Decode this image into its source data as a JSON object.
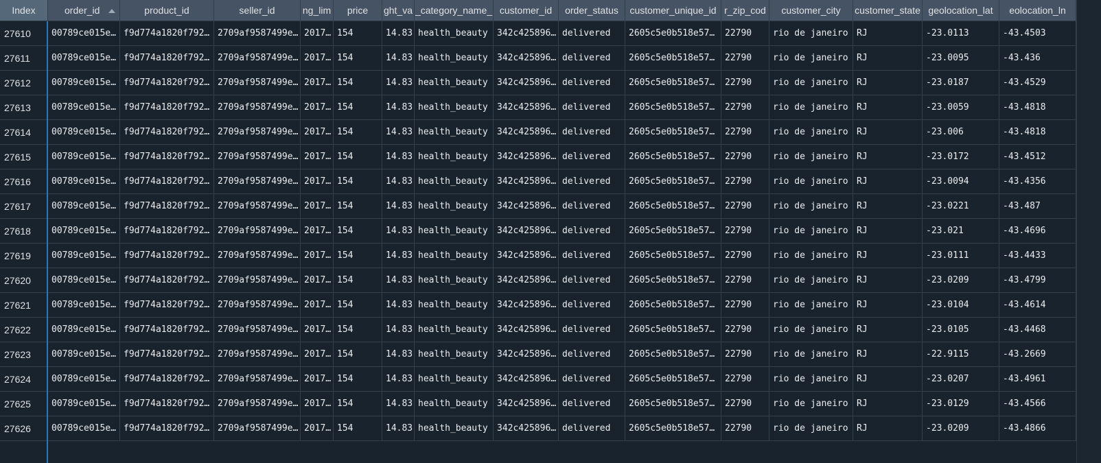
{
  "table": {
    "index_header": "Index",
    "columns": [
      "order_id",
      "product_id",
      "seller_id",
      "ng_lim",
      "price",
      "ght_va",
      "_category_name_",
      "customer_id",
      "order_status",
      "customer_unique_id",
      "r_zip_cod",
      "customer_city",
      "customer_state",
      "geolocation_lat",
      "eolocation_ln"
    ],
    "sorted_column": "order_id",
    "rows": [
      {
        "index": "27610",
        "cells": [
          "00789ce015e…",
          "f9d774a1820f792…",
          "2709af9587499e…",
          "2017…",
          "154",
          "14.83",
          "health_beauty",
          "342c425896…",
          "delivered",
          "2605c5e0b518e57…",
          "22790",
          "rio de janeiro",
          "RJ",
          "-23.0113",
          "-43.4503"
        ]
      },
      {
        "index": "27611",
        "cells": [
          "00789ce015e…",
          "f9d774a1820f792…",
          "2709af9587499e…",
          "2017…",
          "154",
          "14.83",
          "health_beauty",
          "342c425896…",
          "delivered",
          "2605c5e0b518e57…",
          "22790",
          "rio de janeiro",
          "RJ",
          "-23.0095",
          "-43.436"
        ]
      },
      {
        "index": "27612",
        "cells": [
          "00789ce015e…",
          "f9d774a1820f792…",
          "2709af9587499e…",
          "2017…",
          "154",
          "14.83",
          "health_beauty",
          "342c425896…",
          "delivered",
          "2605c5e0b518e57…",
          "22790",
          "rio de janeiro",
          "RJ",
          "-23.0187",
          "-43.4529"
        ]
      },
      {
        "index": "27613",
        "cells": [
          "00789ce015e…",
          "f9d774a1820f792…",
          "2709af9587499e…",
          "2017…",
          "154",
          "14.83",
          "health_beauty",
          "342c425896…",
          "delivered",
          "2605c5e0b518e57…",
          "22790",
          "rio de janeiro",
          "RJ",
          "-23.0059",
          "-43.4818"
        ]
      },
      {
        "index": "27614",
        "cells": [
          "00789ce015e…",
          "f9d774a1820f792…",
          "2709af9587499e…",
          "2017…",
          "154",
          "14.83",
          "health_beauty",
          "342c425896…",
          "delivered",
          "2605c5e0b518e57…",
          "22790",
          "rio de janeiro",
          "RJ",
          "-23.006",
          "-43.4818"
        ]
      },
      {
        "index": "27615",
        "cells": [
          "00789ce015e…",
          "f9d774a1820f792…",
          "2709af9587499e…",
          "2017…",
          "154",
          "14.83",
          "health_beauty",
          "342c425896…",
          "delivered",
          "2605c5e0b518e57…",
          "22790",
          "rio de janeiro",
          "RJ",
          "-23.0172",
          "-43.4512"
        ]
      },
      {
        "index": "27616",
        "cells": [
          "00789ce015e…",
          "f9d774a1820f792…",
          "2709af9587499e…",
          "2017…",
          "154",
          "14.83",
          "health_beauty",
          "342c425896…",
          "delivered",
          "2605c5e0b518e57…",
          "22790",
          "rio de janeiro",
          "RJ",
          "-23.0094",
          "-43.4356"
        ]
      },
      {
        "index": "27617",
        "cells": [
          "00789ce015e…",
          "f9d774a1820f792…",
          "2709af9587499e…",
          "2017…",
          "154",
          "14.83",
          "health_beauty",
          "342c425896…",
          "delivered",
          "2605c5e0b518e57…",
          "22790",
          "rio de janeiro",
          "RJ",
          "-23.0221",
          "-43.487"
        ]
      },
      {
        "index": "27618",
        "cells": [
          "00789ce015e…",
          "f9d774a1820f792…",
          "2709af9587499e…",
          "2017…",
          "154",
          "14.83",
          "health_beauty",
          "342c425896…",
          "delivered",
          "2605c5e0b518e57…",
          "22790",
          "rio de janeiro",
          "RJ",
          "-23.021",
          "-43.4696"
        ]
      },
      {
        "index": "27619",
        "cells": [
          "00789ce015e…",
          "f9d774a1820f792…",
          "2709af9587499e…",
          "2017…",
          "154",
          "14.83",
          "health_beauty",
          "342c425896…",
          "delivered",
          "2605c5e0b518e57…",
          "22790",
          "rio de janeiro",
          "RJ",
          "-23.0111",
          "-43.4433"
        ]
      },
      {
        "index": "27620",
        "cells": [
          "00789ce015e…",
          "f9d774a1820f792…",
          "2709af9587499e…",
          "2017…",
          "154",
          "14.83",
          "health_beauty",
          "342c425896…",
          "delivered",
          "2605c5e0b518e57…",
          "22790",
          "rio de janeiro",
          "RJ",
          "-23.0209",
          "-43.4799"
        ]
      },
      {
        "index": "27621",
        "cells": [
          "00789ce015e…",
          "f9d774a1820f792…",
          "2709af9587499e…",
          "2017…",
          "154",
          "14.83",
          "health_beauty",
          "342c425896…",
          "delivered",
          "2605c5e0b518e57…",
          "22790",
          "rio de janeiro",
          "RJ",
          "-23.0104",
          "-43.4614"
        ]
      },
      {
        "index": "27622",
        "cells": [
          "00789ce015e…",
          "f9d774a1820f792…",
          "2709af9587499e…",
          "2017…",
          "154",
          "14.83",
          "health_beauty",
          "342c425896…",
          "delivered",
          "2605c5e0b518e57…",
          "22790",
          "rio de janeiro",
          "RJ",
          "-23.0105",
          "-43.4468"
        ]
      },
      {
        "index": "27623",
        "cells": [
          "00789ce015e…",
          "f9d774a1820f792…",
          "2709af9587499e…",
          "2017…",
          "154",
          "14.83",
          "health_beauty",
          "342c425896…",
          "delivered",
          "2605c5e0b518e57…",
          "22790",
          "rio de janeiro",
          "RJ",
          "-22.9115",
          "-43.2669"
        ]
      },
      {
        "index": "27624",
        "cells": [
          "00789ce015e…",
          "f9d774a1820f792…",
          "2709af9587499e…",
          "2017…",
          "154",
          "14.83",
          "health_beauty",
          "342c425896…",
          "delivered",
          "2605c5e0b518e57…",
          "22790",
          "rio de janeiro",
          "RJ",
          "-23.0207",
          "-43.4961"
        ]
      },
      {
        "index": "27625",
        "cells": [
          "00789ce015e…",
          "f9d774a1820f792…",
          "2709af9587499e…",
          "2017…",
          "154",
          "14.83",
          "health_beauty",
          "342c425896…",
          "delivered",
          "2605c5e0b518e57…",
          "22790",
          "rio de janeiro",
          "RJ",
          "-23.0129",
          "-43.4566"
        ]
      },
      {
        "index": "27626",
        "cells": [
          "00789ce015e…",
          "f9d774a1820f792…",
          "2709af9587499e…",
          "2017…",
          "154",
          "14.83",
          "health_beauty",
          "342c425896…",
          "delivered",
          "2605c5e0b518e57…",
          "22790",
          "rio de janeiro",
          "RJ",
          "-23.0209",
          "-43.4866"
        ]
      }
    ]
  },
  "colors": {
    "background": "#19232d",
    "header": "#455364",
    "index_header": "#54687a",
    "text": "#e0e1e3",
    "grid": "#32414b",
    "selection_border": "#2c77b7"
  }
}
